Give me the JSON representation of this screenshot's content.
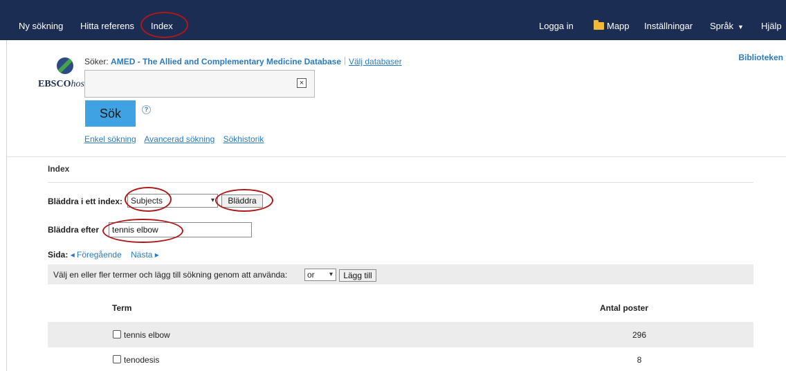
{
  "topbar": {
    "left_nav": [
      "Ny sökning",
      "Hitta referens",
      "Index"
    ],
    "login": "Logga in",
    "folder": "Mapp",
    "settings": "Inställningar",
    "language": "Språk",
    "help": "Hjälp"
  },
  "logo": {
    "brand": "EBSCO",
    "brand_suffix": "host"
  },
  "search": {
    "searching_label": "Söker:",
    "database": "AMED - The Allied and Complementary Medicine Database",
    "choose_db": "Välj databaser",
    "query": "",
    "clear_symbol": "×",
    "submit": "Sök",
    "help_symbol": "?",
    "links": [
      "Enkel sökning",
      "Avancerad sökning",
      "Sökhistorik"
    ]
  },
  "library_link": "Biblioteken",
  "index_panel": {
    "title": "Index",
    "browse_index_label": "Bläddra i ett index:",
    "browse_index_value": "Subjects",
    "browse_button": "Bläddra",
    "browse_for_label": "Bläddra efter",
    "browse_for_value": "tennis elbow",
    "page_label": "Sida:",
    "prev": "◂ Föregående",
    "next": "Nästa ▸",
    "select_terms_text": "Välj en eller fler termer och lägg till sökning genom att använda:",
    "operator": "or",
    "add_button": "Lägg till",
    "table": {
      "headers": [
        "Term",
        "Antal poster"
      ],
      "rows": [
        {
          "term": "tennis elbow",
          "count": "296"
        },
        {
          "term": "tenodesis",
          "count": "8"
        }
      ]
    }
  },
  "annotation_color": "#b01818"
}
